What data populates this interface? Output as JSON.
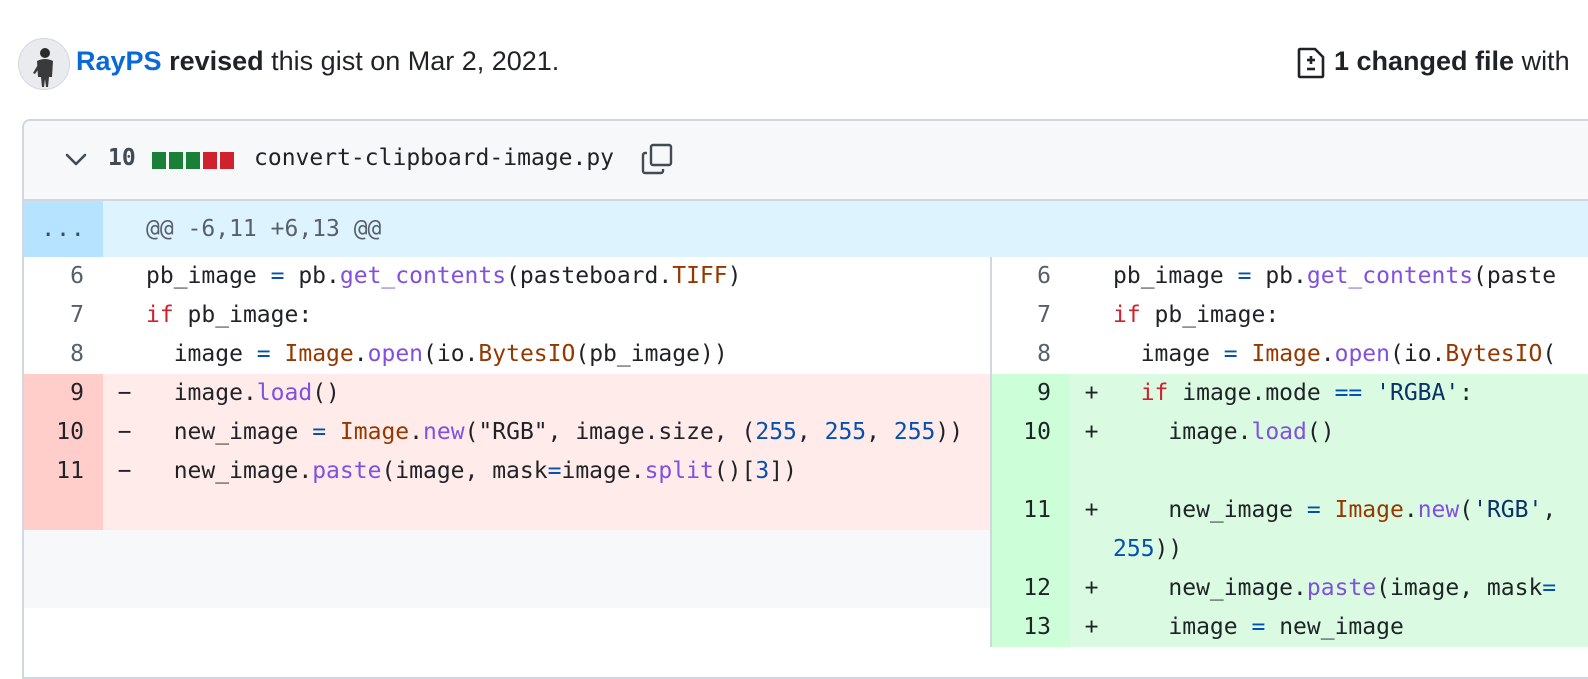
{
  "header": {
    "author": "RayPS",
    "action": "revised",
    "rest": " this gist on Mar 2, 2021.",
    "changed_files": "1 changed file",
    "changed_tail": " with"
  },
  "file": {
    "changes_count": "10",
    "filename": "convert-clipboard-image.py",
    "diffstat": [
      "add",
      "add",
      "add",
      "del",
      "del"
    ],
    "diffstat_colors": {
      "add": "#1a7f37",
      "del": "#cf222e"
    }
  },
  "hunk": {
    "expand_label": "...",
    "header": "@@ -6,11 +6,13 @@"
  },
  "left_lines": [
    {
      "num": "6",
      "marker": "",
      "type": "ctx",
      "tokens": [
        [
          "pb_image ",
          ""
        ],
        [
          "=",
          "o"
        ],
        [
          " pb.",
          ""
        ],
        [
          "get_contents",
          "f"
        ],
        [
          "(pasteboard.",
          ""
        ],
        [
          "TIFF",
          "c"
        ],
        [
          ")",
          ""
        ]
      ]
    },
    {
      "num": "7",
      "marker": "",
      "type": "ctx",
      "tokens": [
        [
          "if",
          "k"
        ],
        [
          " pb_image:",
          ""
        ]
      ]
    },
    {
      "num": "8",
      "marker": "",
      "type": "ctx",
      "tokens": [
        [
          "  image ",
          ""
        ],
        [
          "=",
          "o"
        ],
        [
          " ",
          ""
        ],
        [
          "Image",
          "c"
        ],
        [
          ".",
          ""
        ],
        [
          "open",
          "f"
        ],
        [
          "(io.",
          ""
        ],
        [
          "BytesIO",
          "c"
        ],
        [
          "(pb_image))",
          ""
        ]
      ]
    },
    {
      "num": "9",
      "marker": "−",
      "type": "del",
      "tokens": [
        [
          "  image.",
          ""
        ],
        [
          "load",
          "f"
        ],
        [
          "()",
          ""
        ]
      ]
    },
    {
      "num": "10",
      "marker": "−",
      "type": "del",
      "tokens": [
        [
          "  new_image ",
          ""
        ],
        [
          "=",
          "o"
        ],
        [
          " ",
          ""
        ],
        [
          "Image",
          "c"
        ],
        [
          ".",
          ""
        ],
        [
          "new",
          "f"
        ],
        [
          "(\"RGB\", image.size, (",
          ""
        ],
        [
          "255",
          "n"
        ],
        [
          ", ",
          ""
        ],
        [
          "255",
          "n"
        ],
        [
          ", ",
          ""
        ],
        [
          "255",
          "n"
        ],
        [
          "))",
          ""
        ]
      ]
    },
    {
      "num": "11",
      "marker": "−",
      "type": "del",
      "tokens": [
        [
          "  new_image.",
          ""
        ],
        [
          "paste",
          "f"
        ],
        [
          "(image, mask",
          ""
        ],
        [
          "=",
          "o"
        ],
        [
          "image.",
          ""
        ],
        [
          "split",
          "f"
        ],
        [
          "()[",
          ""
        ],
        [
          "3",
          "n"
        ],
        [
          "])",
          ""
        ]
      ]
    },
    {
      "num": "",
      "marker": "",
      "type": "del-pad",
      "tokens": []
    },
    {
      "num": "",
      "marker": "",
      "type": "empty",
      "tokens": []
    },
    {
      "num": "",
      "marker": "",
      "type": "empty",
      "tokens": []
    }
  ],
  "right_lines": [
    {
      "num": "6",
      "marker": "",
      "type": "ctx",
      "tokens": [
        [
          "pb_image ",
          ""
        ],
        [
          "=",
          "o"
        ],
        [
          " pb.",
          ""
        ],
        [
          "get_contents",
          "f"
        ],
        [
          "(paste",
          ""
        ]
      ]
    },
    {
      "num": "7",
      "marker": "",
      "type": "ctx",
      "tokens": [
        [
          "if",
          "k"
        ],
        [
          " pb_image:",
          ""
        ]
      ]
    },
    {
      "num": "8",
      "marker": "",
      "type": "ctx",
      "tokens": [
        [
          "  image ",
          ""
        ],
        [
          "=",
          "o"
        ],
        [
          " ",
          ""
        ],
        [
          "Image",
          "c"
        ],
        [
          ".",
          ""
        ],
        [
          "open",
          "f"
        ],
        [
          "(io.",
          ""
        ],
        [
          "BytesIO",
          "c"
        ],
        [
          "(",
          ""
        ]
      ]
    },
    {
      "num": "9",
      "marker": "+",
      "type": "add",
      "tokens": [
        [
          "  ",
          ""
        ],
        [
          "if",
          "k"
        ],
        [
          " image.mode ",
          ""
        ],
        [
          "==",
          "o"
        ],
        [
          " ",
          ""
        ],
        [
          "'RGBA'",
          "s"
        ],
        [
          ":",
          ""
        ]
      ]
    },
    {
      "num": "10",
      "marker": "+",
      "type": "add",
      "tokens": [
        [
          "    image.",
          ""
        ],
        [
          "load",
          "f"
        ],
        [
          "()",
          ""
        ]
      ]
    },
    {
      "num": "",
      "marker": "",
      "type": "add-pad",
      "tokens": []
    },
    {
      "num": "11",
      "marker": "+",
      "type": "add",
      "tokens": [
        [
          "    new_image ",
          ""
        ],
        [
          "=",
          "o"
        ],
        [
          " ",
          ""
        ],
        [
          "Image",
          "c"
        ],
        [
          ".",
          ""
        ],
        [
          "new",
          "f"
        ],
        [
          "(",
          ""
        ],
        [
          "'RGB'",
          "s"
        ],
        [
          ",",
          ""
        ]
      ]
    },
    {
      "num": "",
      "marker": "",
      "type": "add-pad",
      "tokens": [
        [
          "255",
          "n"
        ],
        [
          "))",
          ""
        ]
      ]
    },
    {
      "num": "12",
      "marker": "+",
      "type": "add",
      "tokens": [
        [
          "    new_image.",
          ""
        ],
        [
          "paste",
          "f"
        ],
        [
          "(image, mask",
          ""
        ],
        [
          "=",
          "o"
        ]
      ]
    },
    {
      "num": "13",
      "marker": "+",
      "type": "add",
      "tokens": [
        [
          "    image ",
          ""
        ],
        [
          "=",
          "o"
        ],
        [
          " new_image",
          ""
        ]
      ]
    }
  ]
}
